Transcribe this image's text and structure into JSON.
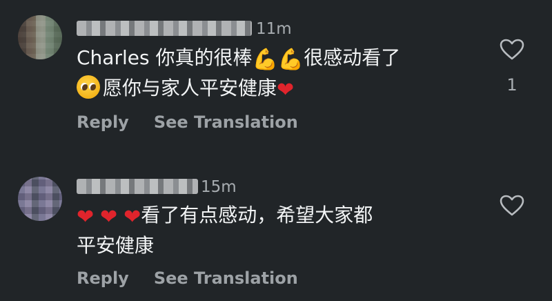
{
  "comments": [
    {
      "timestamp": "11m",
      "text_prefix": "Charles 你真的很棒",
      "text_mid": "很感动看了",
      "text_line2": "愿你与家人平安健康",
      "emojis": {
        "muscle": "💪",
        "heart": "❤",
        "pleading": "🥹"
      },
      "reply_label": "Reply",
      "translate_label": "See Translation",
      "like_count": "1",
      "liked": false
    },
    {
      "timestamp": "15m",
      "text_after_hearts": "看了有点感动，希望大家都",
      "text_line2": "平安健康",
      "emojis": {
        "heart": "❤"
      },
      "reply_label": "Reply",
      "translate_label": "See Translation",
      "liked": false
    }
  ],
  "colors": {
    "background": "#212528",
    "text": "#f2f4f5",
    "muted": "#9da2a6",
    "heart": "#e0242c",
    "muscle": "#f2b21b"
  }
}
